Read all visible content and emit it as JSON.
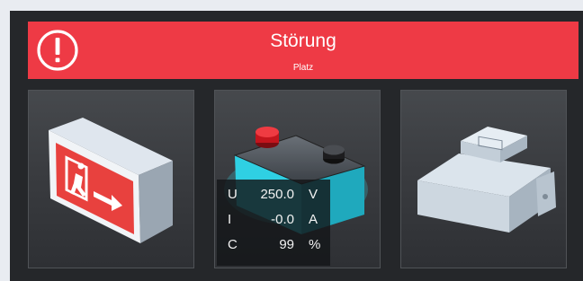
{
  "alarm": {
    "title": "Störung",
    "subtitle": "Platz",
    "icon": "alert-circle-icon",
    "color": "#ee3a45"
  },
  "tiles": [
    {
      "icon": "emergency-exit-light-icon"
    },
    {
      "icon": "battery-icon",
      "readout": [
        {
          "symbol": "U",
          "value": "250.0",
          "unit": "V"
        },
        {
          "symbol": "I",
          "value": "-0.0",
          "unit": "A"
        },
        {
          "symbol": "C",
          "value": "99",
          "unit": "%"
        }
      ]
    },
    {
      "icon": "din-rail-module-icon"
    }
  ]
}
